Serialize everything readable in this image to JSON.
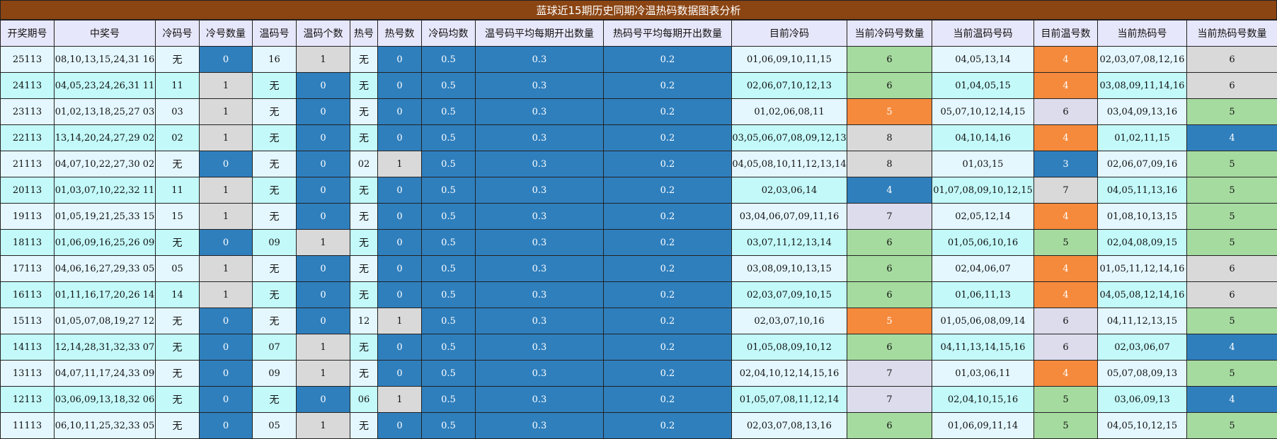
{
  "title": "蓝球近15期历史同期冷温热码数据图表分析",
  "colors": {
    "title_bg": "#8b4513",
    "header_bg": "#e7e7fb",
    "blue": "#2f7fbd",
    "gray": "#d9d9d9",
    "green": "#a6dba0",
    "orange": "#f58a3c",
    "lavender": "#dcdcec",
    "cyan_row": "#c3f9f9",
    "light_row": "#e4f7ff"
  },
  "headers": [
    "开奖期号",
    "中奖号",
    "冷码号",
    "冷号数量",
    "温码号",
    "温码个数",
    "热号",
    "热号数",
    "冷码均数",
    "温号码平均每期开出数量",
    "热码号平均每期开出数量",
    "目前冷码",
    "当前冷码号数量",
    "当前温码号码",
    "目前温号数",
    "当前热码号",
    "当前热码号数量"
  ],
  "rows": [
    {
      "period": "25113",
      "numbers": "08,10,13,15,24,31 16",
      "cold": "无",
      "cold_count": "0",
      "warm": "16",
      "warm_count": "1",
      "hot": "无",
      "hot_count": "0",
      "cold_avg": "0.5",
      "warm_avg": "0.3",
      "hot_avg": "0.2",
      "cur_cold": "01,06,09,10,11,15",
      "cur_cold_count": "6",
      "cur_warm": "04,05,13,14",
      "cur_warm_count": "4",
      "cur_hot": "02,03,07,08,12,16",
      "cur_hot_count": "6"
    },
    {
      "period": "24113",
      "numbers": "04,05,23,24,26,31 11",
      "cold": "11",
      "cold_count": "1",
      "warm": "无",
      "warm_count": "0",
      "hot": "无",
      "hot_count": "0",
      "cold_avg": "0.5",
      "warm_avg": "0.3",
      "hot_avg": "0.2",
      "cur_cold": "02,06,07,10,12,13",
      "cur_cold_count": "6",
      "cur_warm": "01,04,05,15",
      "cur_warm_count": "4",
      "cur_hot": "03,08,09,11,14,16",
      "cur_hot_count": "6"
    },
    {
      "period": "23113",
      "numbers": "01,02,13,18,25,27 03",
      "cold": "03",
      "cold_count": "1",
      "warm": "无",
      "warm_count": "0",
      "hot": "无",
      "hot_count": "0",
      "cold_avg": "0.5",
      "warm_avg": "0.3",
      "hot_avg": "0.2",
      "cur_cold": "01,02,06,08,11",
      "cur_cold_count": "5",
      "cur_warm": "05,07,10,12,14,15",
      "cur_warm_count": "6",
      "cur_hot": "03,04,09,13,16",
      "cur_hot_count": "5"
    },
    {
      "period": "22113",
      "numbers": "13,14,20,24,27,29 02",
      "cold": "02",
      "cold_count": "1",
      "warm": "无",
      "warm_count": "0",
      "hot": "无",
      "hot_count": "0",
      "cold_avg": "0.5",
      "warm_avg": "0.3",
      "hot_avg": "0.2",
      "cur_cold": "03,05,06,07,08,09,12,13",
      "cur_cold_count": "8",
      "cur_warm": "04,10,14,16",
      "cur_warm_count": "4",
      "cur_hot": "01,02,11,15",
      "cur_hot_count": "4"
    },
    {
      "period": "21113",
      "numbers": "04,07,10,22,27,30 02",
      "cold": "无",
      "cold_count": "0",
      "warm": "无",
      "warm_count": "0",
      "hot": "02",
      "hot_count": "1",
      "cold_avg": "0.5",
      "warm_avg": "0.3",
      "hot_avg": "0.2",
      "cur_cold": "04,05,08,10,11,12,13,14",
      "cur_cold_count": "8",
      "cur_warm": "01,03,15",
      "cur_warm_count": "3",
      "cur_hot": "02,06,07,09,16",
      "cur_hot_count": "5"
    },
    {
      "period": "20113",
      "numbers": "01,03,07,10,22,32 11",
      "cold": "11",
      "cold_count": "1",
      "warm": "无",
      "warm_count": "0",
      "hot": "无",
      "hot_count": "0",
      "cold_avg": "0.5",
      "warm_avg": "0.3",
      "hot_avg": "0.2",
      "cur_cold": "02,03,06,14",
      "cur_cold_count": "4",
      "cur_warm": "01,07,08,09,10,12,15",
      "cur_warm_count": "7",
      "cur_hot": "04,05,11,13,16",
      "cur_hot_count": "5"
    },
    {
      "period": "19113",
      "numbers": "01,05,19,21,25,33 15",
      "cold": "15",
      "cold_count": "1",
      "warm": "无",
      "warm_count": "0",
      "hot": "无",
      "hot_count": "0",
      "cold_avg": "0.5",
      "warm_avg": "0.3",
      "hot_avg": "0.2",
      "cur_cold": "03,04,06,07,09,11,16",
      "cur_cold_count": "7",
      "cur_warm": "02,05,12,14",
      "cur_warm_count": "4",
      "cur_hot": "01,08,10,13,15",
      "cur_hot_count": "5"
    },
    {
      "period": "18113",
      "numbers": "01,06,09,16,25,26 09",
      "cold": "无",
      "cold_count": "0",
      "warm": "09",
      "warm_count": "1",
      "hot": "无",
      "hot_count": "0",
      "cold_avg": "0.5",
      "warm_avg": "0.3",
      "hot_avg": "0.2",
      "cur_cold": "03,07,11,12,13,14",
      "cur_cold_count": "6",
      "cur_warm": "01,05,06,10,16",
      "cur_warm_count": "5",
      "cur_hot": "02,04,08,09,15",
      "cur_hot_count": "5"
    },
    {
      "period": "17113",
      "numbers": "04,06,16,27,29,33 05",
      "cold": "05",
      "cold_count": "1",
      "warm": "无",
      "warm_count": "0",
      "hot": "无",
      "hot_count": "0",
      "cold_avg": "0.5",
      "warm_avg": "0.3",
      "hot_avg": "0.2",
      "cur_cold": "03,08,09,10,13,15",
      "cur_cold_count": "6",
      "cur_warm": "02,04,06,07",
      "cur_warm_count": "4",
      "cur_hot": "01,05,11,12,14,16",
      "cur_hot_count": "6"
    },
    {
      "period": "16113",
      "numbers": "01,11,16,17,20,26 14",
      "cold": "14",
      "cold_count": "1",
      "warm": "无",
      "warm_count": "0",
      "hot": "无",
      "hot_count": "0",
      "cold_avg": "0.5",
      "warm_avg": "0.3",
      "hot_avg": "0.2",
      "cur_cold": "02,03,07,09,10,15",
      "cur_cold_count": "6",
      "cur_warm": "01,06,11,13",
      "cur_warm_count": "4",
      "cur_hot": "04,05,08,12,14,16",
      "cur_hot_count": "6"
    },
    {
      "period": "15113",
      "numbers": "01,05,07,08,19,27 12",
      "cold": "无",
      "cold_count": "0",
      "warm": "无",
      "warm_count": "0",
      "hot": "12",
      "hot_count": "1",
      "cold_avg": "0.5",
      "warm_avg": "0.3",
      "hot_avg": "0.2",
      "cur_cold": "02,03,07,10,16",
      "cur_cold_count": "5",
      "cur_warm": "01,05,06,08,09,14",
      "cur_warm_count": "6",
      "cur_hot": "04,11,12,13,15",
      "cur_hot_count": "5"
    },
    {
      "period": "14113",
      "numbers": "12,14,28,31,32,33 07",
      "cold": "无",
      "cold_count": "0",
      "warm": "07",
      "warm_count": "1",
      "hot": "无",
      "hot_count": "0",
      "cold_avg": "0.5",
      "warm_avg": "0.3",
      "hot_avg": "0.2",
      "cur_cold": "01,05,08,09,10,12",
      "cur_cold_count": "6",
      "cur_warm": "04,11,13,14,15,16",
      "cur_warm_count": "6",
      "cur_hot": "02,03,06,07",
      "cur_hot_count": "4"
    },
    {
      "period": "13113",
      "numbers": "04,07,11,17,24,33 09",
      "cold": "无",
      "cold_count": "0",
      "warm": "09",
      "warm_count": "1",
      "hot": "无",
      "hot_count": "0",
      "cold_avg": "0.5",
      "warm_avg": "0.3",
      "hot_avg": "0.2",
      "cur_cold": "02,04,10,12,14,15,16",
      "cur_cold_count": "7",
      "cur_warm": "01,03,06,11",
      "cur_warm_count": "4",
      "cur_hot": "05,07,08,09,13",
      "cur_hot_count": "5"
    },
    {
      "period": "12113",
      "numbers": "03,06,09,13,18,32 06",
      "cold": "无",
      "cold_count": "0",
      "warm": "无",
      "warm_count": "0",
      "hot": "06",
      "hot_count": "1",
      "cold_avg": "0.5",
      "warm_avg": "0.3",
      "hot_avg": "0.2",
      "cur_cold": "01,05,07,08,11,12,14",
      "cur_cold_count": "7",
      "cur_warm": "02,04,10,15,16",
      "cur_warm_count": "5",
      "cur_hot": "03,06,09,13",
      "cur_hot_count": "4"
    },
    {
      "period": "11113",
      "numbers": "06,10,11,25,32,33 05",
      "cold": "无",
      "cold_count": "0",
      "warm": "05",
      "warm_count": "1",
      "hot": "无",
      "hot_count": "0",
      "cold_avg": "0.5",
      "warm_avg": "0.3",
      "hot_avg": "0.2",
      "cur_cold": "02,03,07,08,13,16",
      "cur_cold_count": "6",
      "cur_warm": "01,06,09,11,14",
      "cur_warm_count": "5",
      "cur_hot": "04,05,10,12,15",
      "cur_hot_count": "5"
    }
  ]
}
